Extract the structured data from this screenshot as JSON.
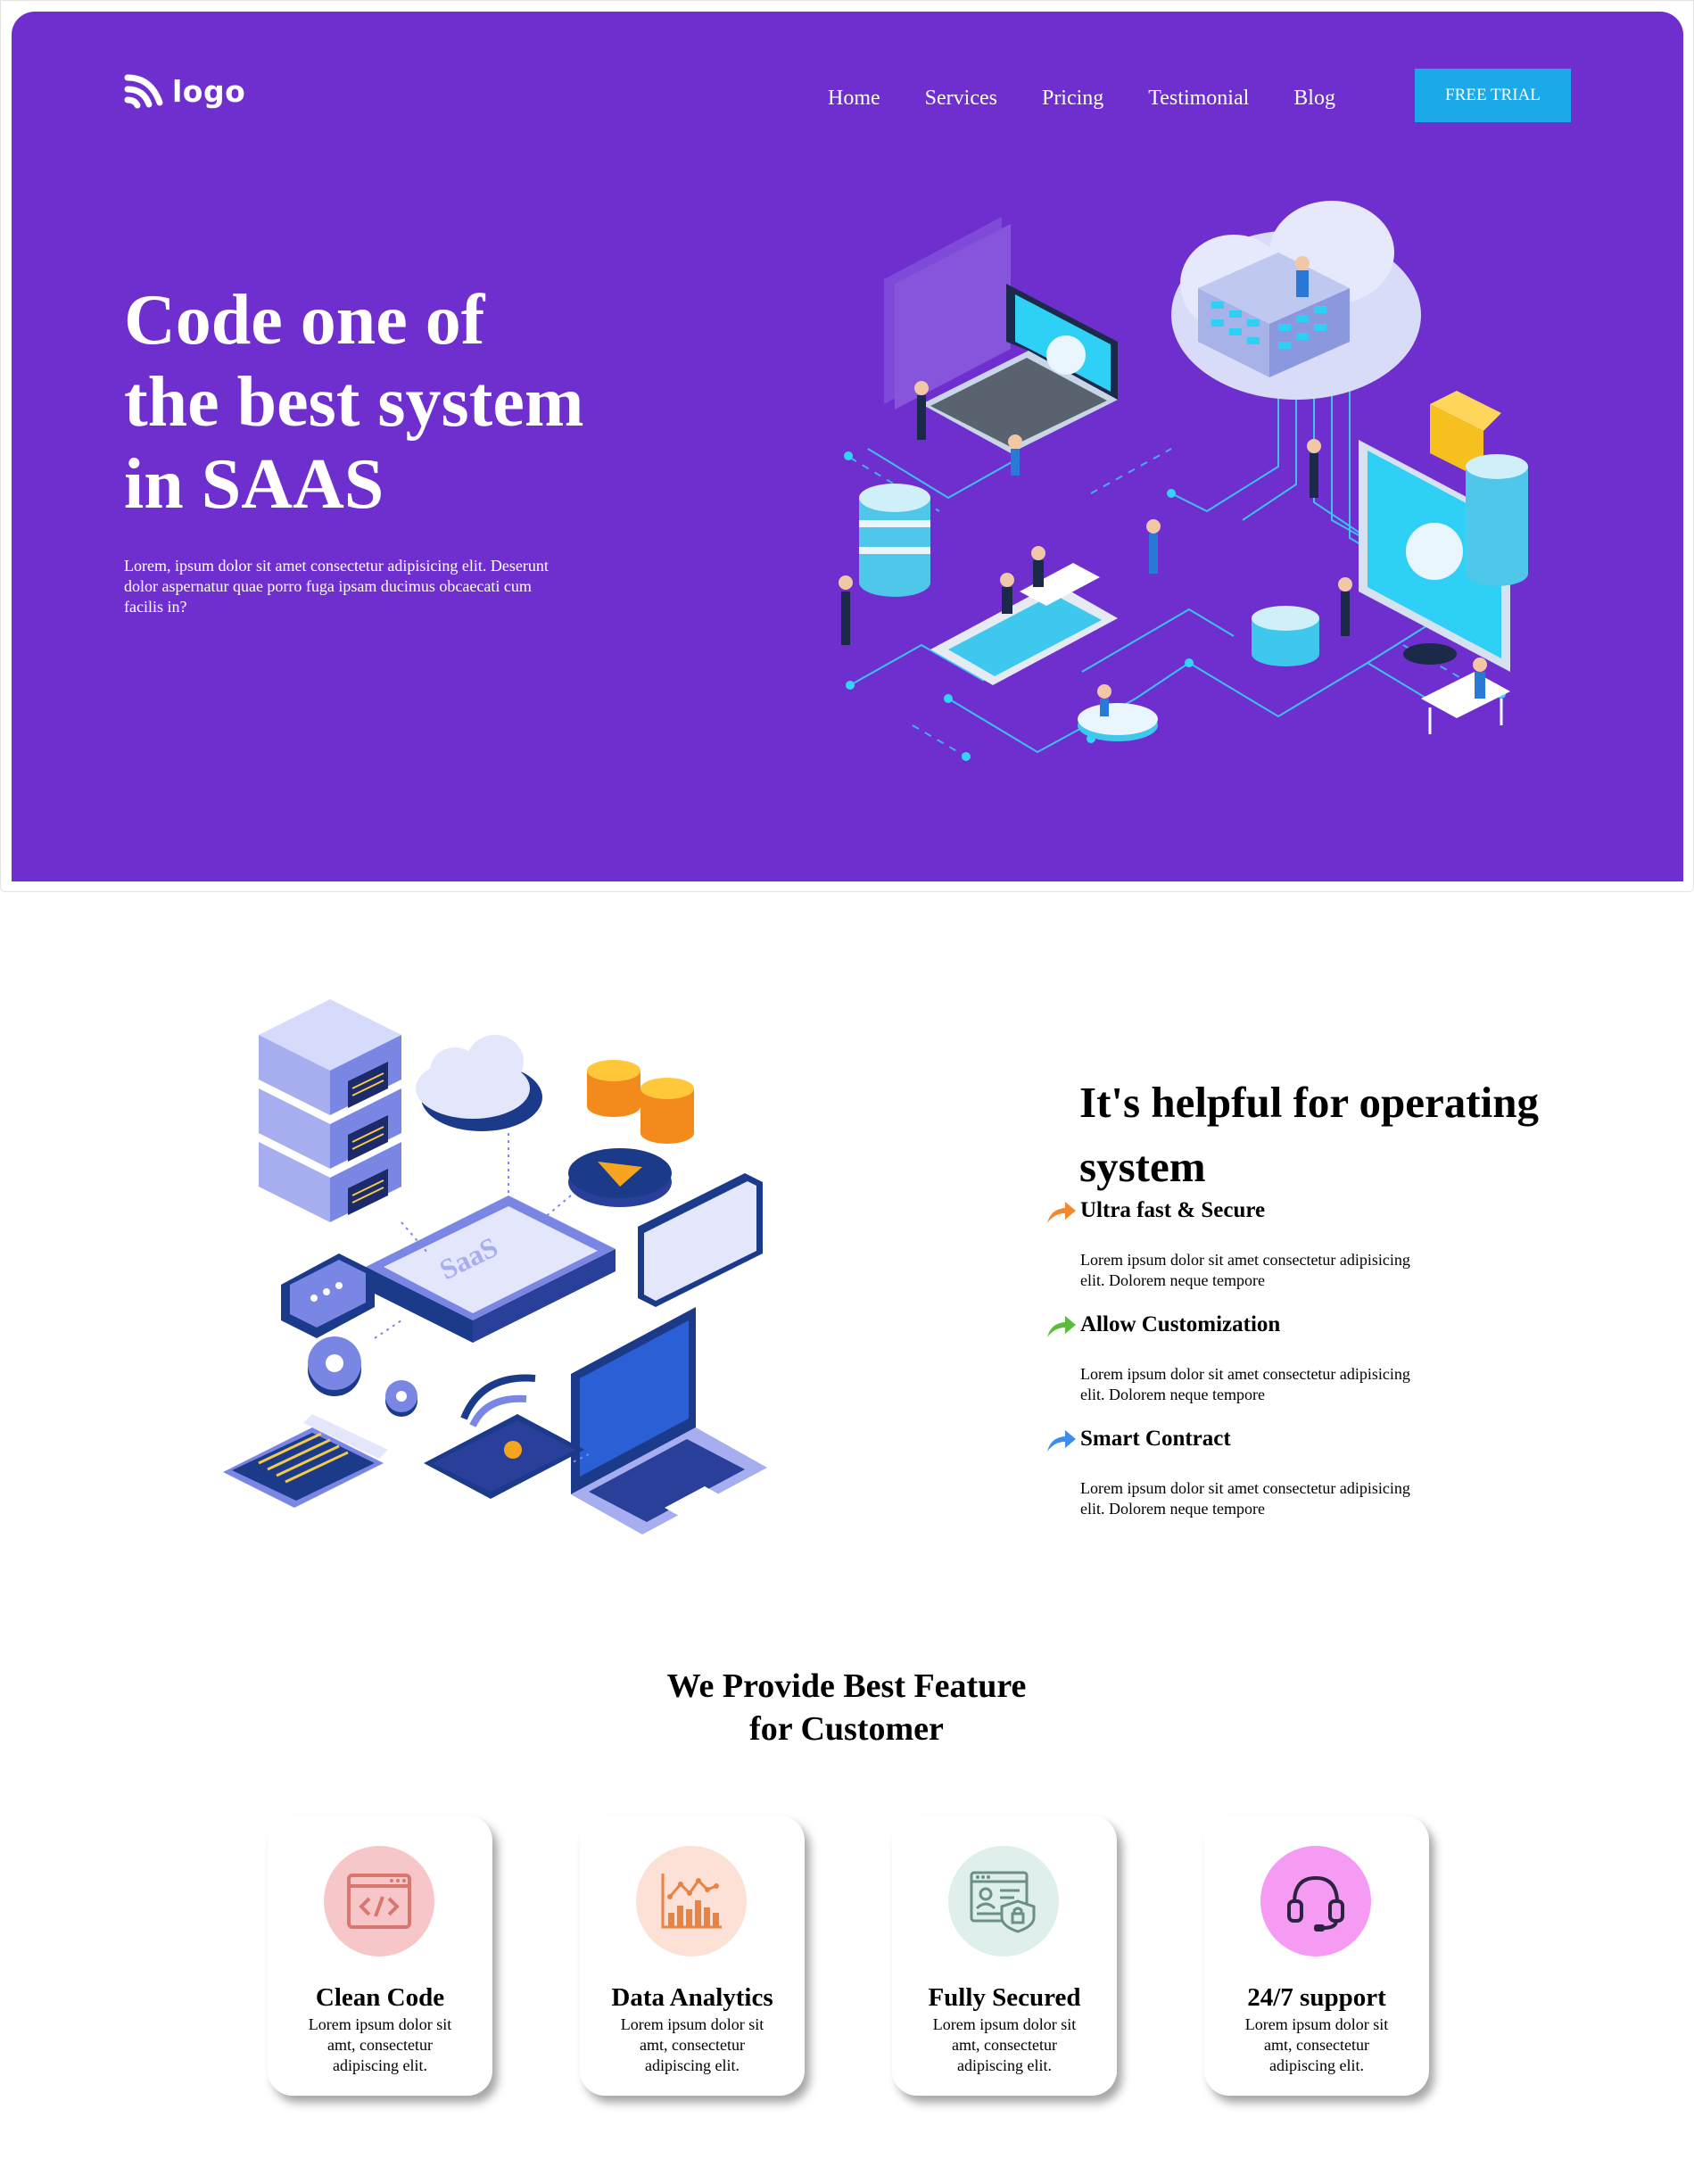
{
  "nav": {
    "logo_text": "logo",
    "items": [
      "Home",
      "Services",
      "Pricing",
      "Testimonial",
      "Blog"
    ],
    "cta_label": "FREE TRIAL"
  },
  "hero": {
    "title_lines": [
      "Code one of",
      "the best system",
      "in SAAS"
    ],
    "description": "Lorem, ipsum dolor sit amet consectetur adipisicing elit. Deserunt dolor aspernatur quae porro fuga ipsam ducimus obcaecati cum facilis in?"
  },
  "about": {
    "illustration_label": "SaaS",
    "title": "It's helpful for operating system",
    "features": [
      {
        "name": "Ultra fast & Secure",
        "description": "Lorem ipsum dolor sit amet consectetur adipisicing elit. Dolorem neque tempore",
        "arrow_color": "#f08a2c"
      },
      {
        "name": "Allow Customization",
        "description": "Lorem ipsum dolor sit amet consectetur adipisicing elit. Dolorem neque tempore",
        "arrow_color": "#5cba3c"
      },
      {
        "name": "Smart Contract",
        "description": "Lorem ipsum dolor sit amet consectetur adipisicing elit. Dolorem neque tempore",
        "arrow_color": "#3c8ee8"
      }
    ]
  },
  "services": {
    "title_lines": [
      "We Provide Best Feature",
      "for Customer"
    ],
    "cards": [
      {
        "title": "Clean Code",
        "description": "Lorem ipsum dolor sit amt, consectetur adipiscing elit.",
        "icon": "code-window-icon",
        "circle_color": "#f7c6c8"
      },
      {
        "title": "Data Analytics",
        "description": "Lorem ipsum dolor sit amt, consectetur adipiscing elit.",
        "icon": "bar-chart-icon",
        "circle_color": "#fde1d6"
      },
      {
        "title": "Fully Secured",
        "description": "Lorem ipsum dolor sit amt, consectetur adipiscing elit.",
        "icon": "secure-profile-icon",
        "circle_color": "#dff0ec"
      },
      {
        "title": "24/7 support",
        "description": "Lorem ipsum dolor sit amt, consectetur adipiscing elit.",
        "icon": "headset-icon",
        "circle_color": "#f69bf3"
      }
    ]
  },
  "colors": {
    "hero_bg": "#6f2fcf",
    "cta_bg": "#1ba9ea"
  }
}
